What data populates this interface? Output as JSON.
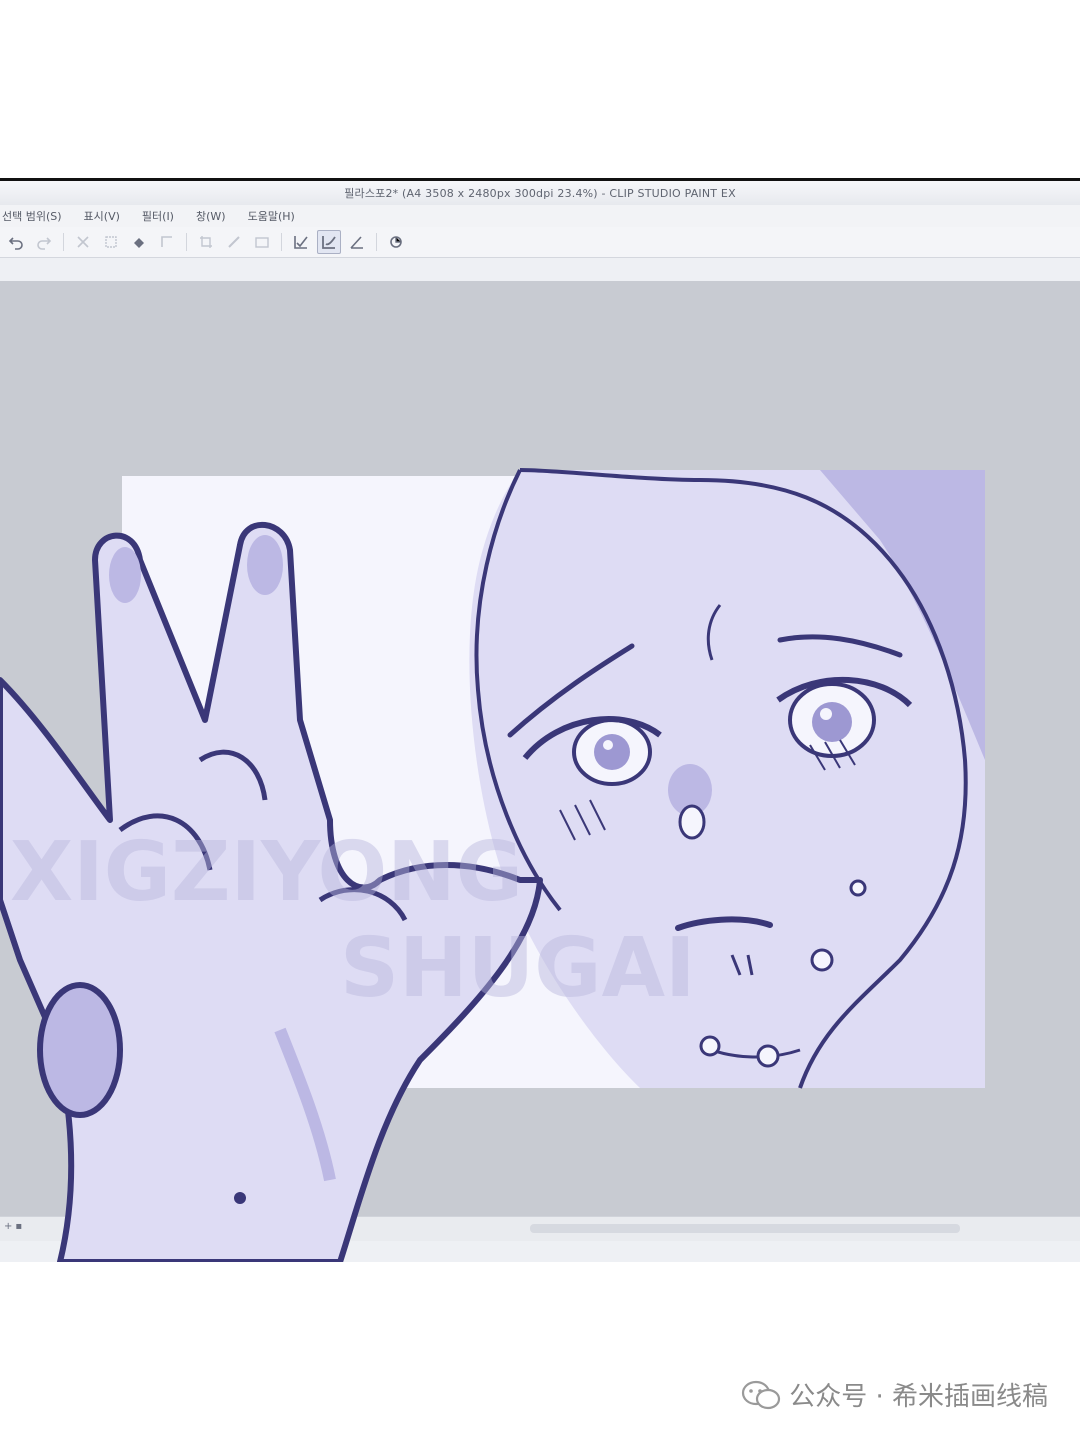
{
  "window": {
    "title": "필라스포2* (A4 3508 x 2480px 300dpi 23.4%) - CLIP STUDIO PAINT EX"
  },
  "menu": {
    "items": [
      "선택 범위(S)",
      "표시(V)",
      "필터(I)",
      "창(W)",
      "도움말(H)"
    ]
  },
  "toolbar": {
    "buttons": [
      {
        "icon": "undo-icon",
        "state": "normal"
      },
      {
        "icon": "redo-icon",
        "state": "faded"
      },
      {
        "icon": "separator"
      },
      {
        "icon": "clear-icon",
        "state": "faded"
      },
      {
        "icon": "transform-icon",
        "state": "faded"
      },
      {
        "icon": "fill-icon",
        "state": "normal"
      },
      {
        "icon": "select-icon",
        "state": "faded"
      },
      {
        "icon": "separator"
      },
      {
        "icon": "crop-icon",
        "state": "faded"
      },
      {
        "icon": "ruler-icon",
        "state": "faded"
      },
      {
        "icon": "frame-icon",
        "state": "faded"
      },
      {
        "icon": "separator"
      },
      {
        "icon": "check-pen-icon",
        "state": "normal"
      },
      {
        "icon": "check-brush-icon",
        "state": "active"
      },
      {
        "icon": "angle-icon",
        "state": "normal"
      },
      {
        "icon": "separator"
      },
      {
        "icon": "color-icon",
        "state": "normal"
      }
    ]
  },
  "canvas": {
    "artwork": "digital line drawing of a crying girl's face and raised hand, lavender tint",
    "watermark_text": [
      "XIGZIYONG",
      "SHUGAI"
    ],
    "colors": {
      "workspace": "#c8cbd2",
      "paper": "#f5f5fd",
      "skin": "#dedcf4",
      "shadow": "#bcb8e4",
      "line": "#3a3778"
    }
  },
  "footer": {
    "account_text": "公众号 · 希米插画线稿",
    "account_icon": "wechat-icon"
  }
}
